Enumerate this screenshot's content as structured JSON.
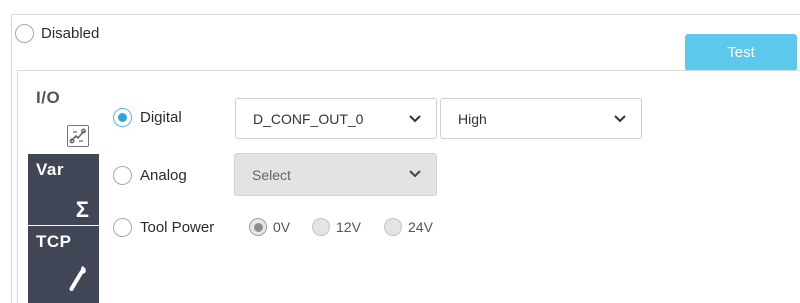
{
  "disabled_option": {
    "label": "Disabled",
    "checked": false
  },
  "test_button": {
    "label": "Test"
  },
  "sidebar": {
    "tabs": [
      {
        "title": "I/O",
        "icon": "circuit-icon",
        "active": true
      },
      {
        "title": "Var",
        "icon": "sigma-icon",
        "active": false
      },
      {
        "title": "TCP",
        "icon": "wrench-icon",
        "active": false
      }
    ]
  },
  "io": {
    "digital": {
      "label": "Digital",
      "checked": true,
      "port": "D_CONF_OUT_0",
      "level": "High"
    },
    "analog": {
      "label": "Analog",
      "checked": false,
      "select_placeholder": "Select"
    },
    "tool_power": {
      "label": "Tool Power",
      "checked": false,
      "options": [
        "0V",
        "12V",
        "24V"
      ],
      "selected": "0V"
    }
  },
  "colors": {
    "accent": "#2ea6dc",
    "test_button": "#5cc9ec",
    "sidebar_dark": "#404656"
  }
}
